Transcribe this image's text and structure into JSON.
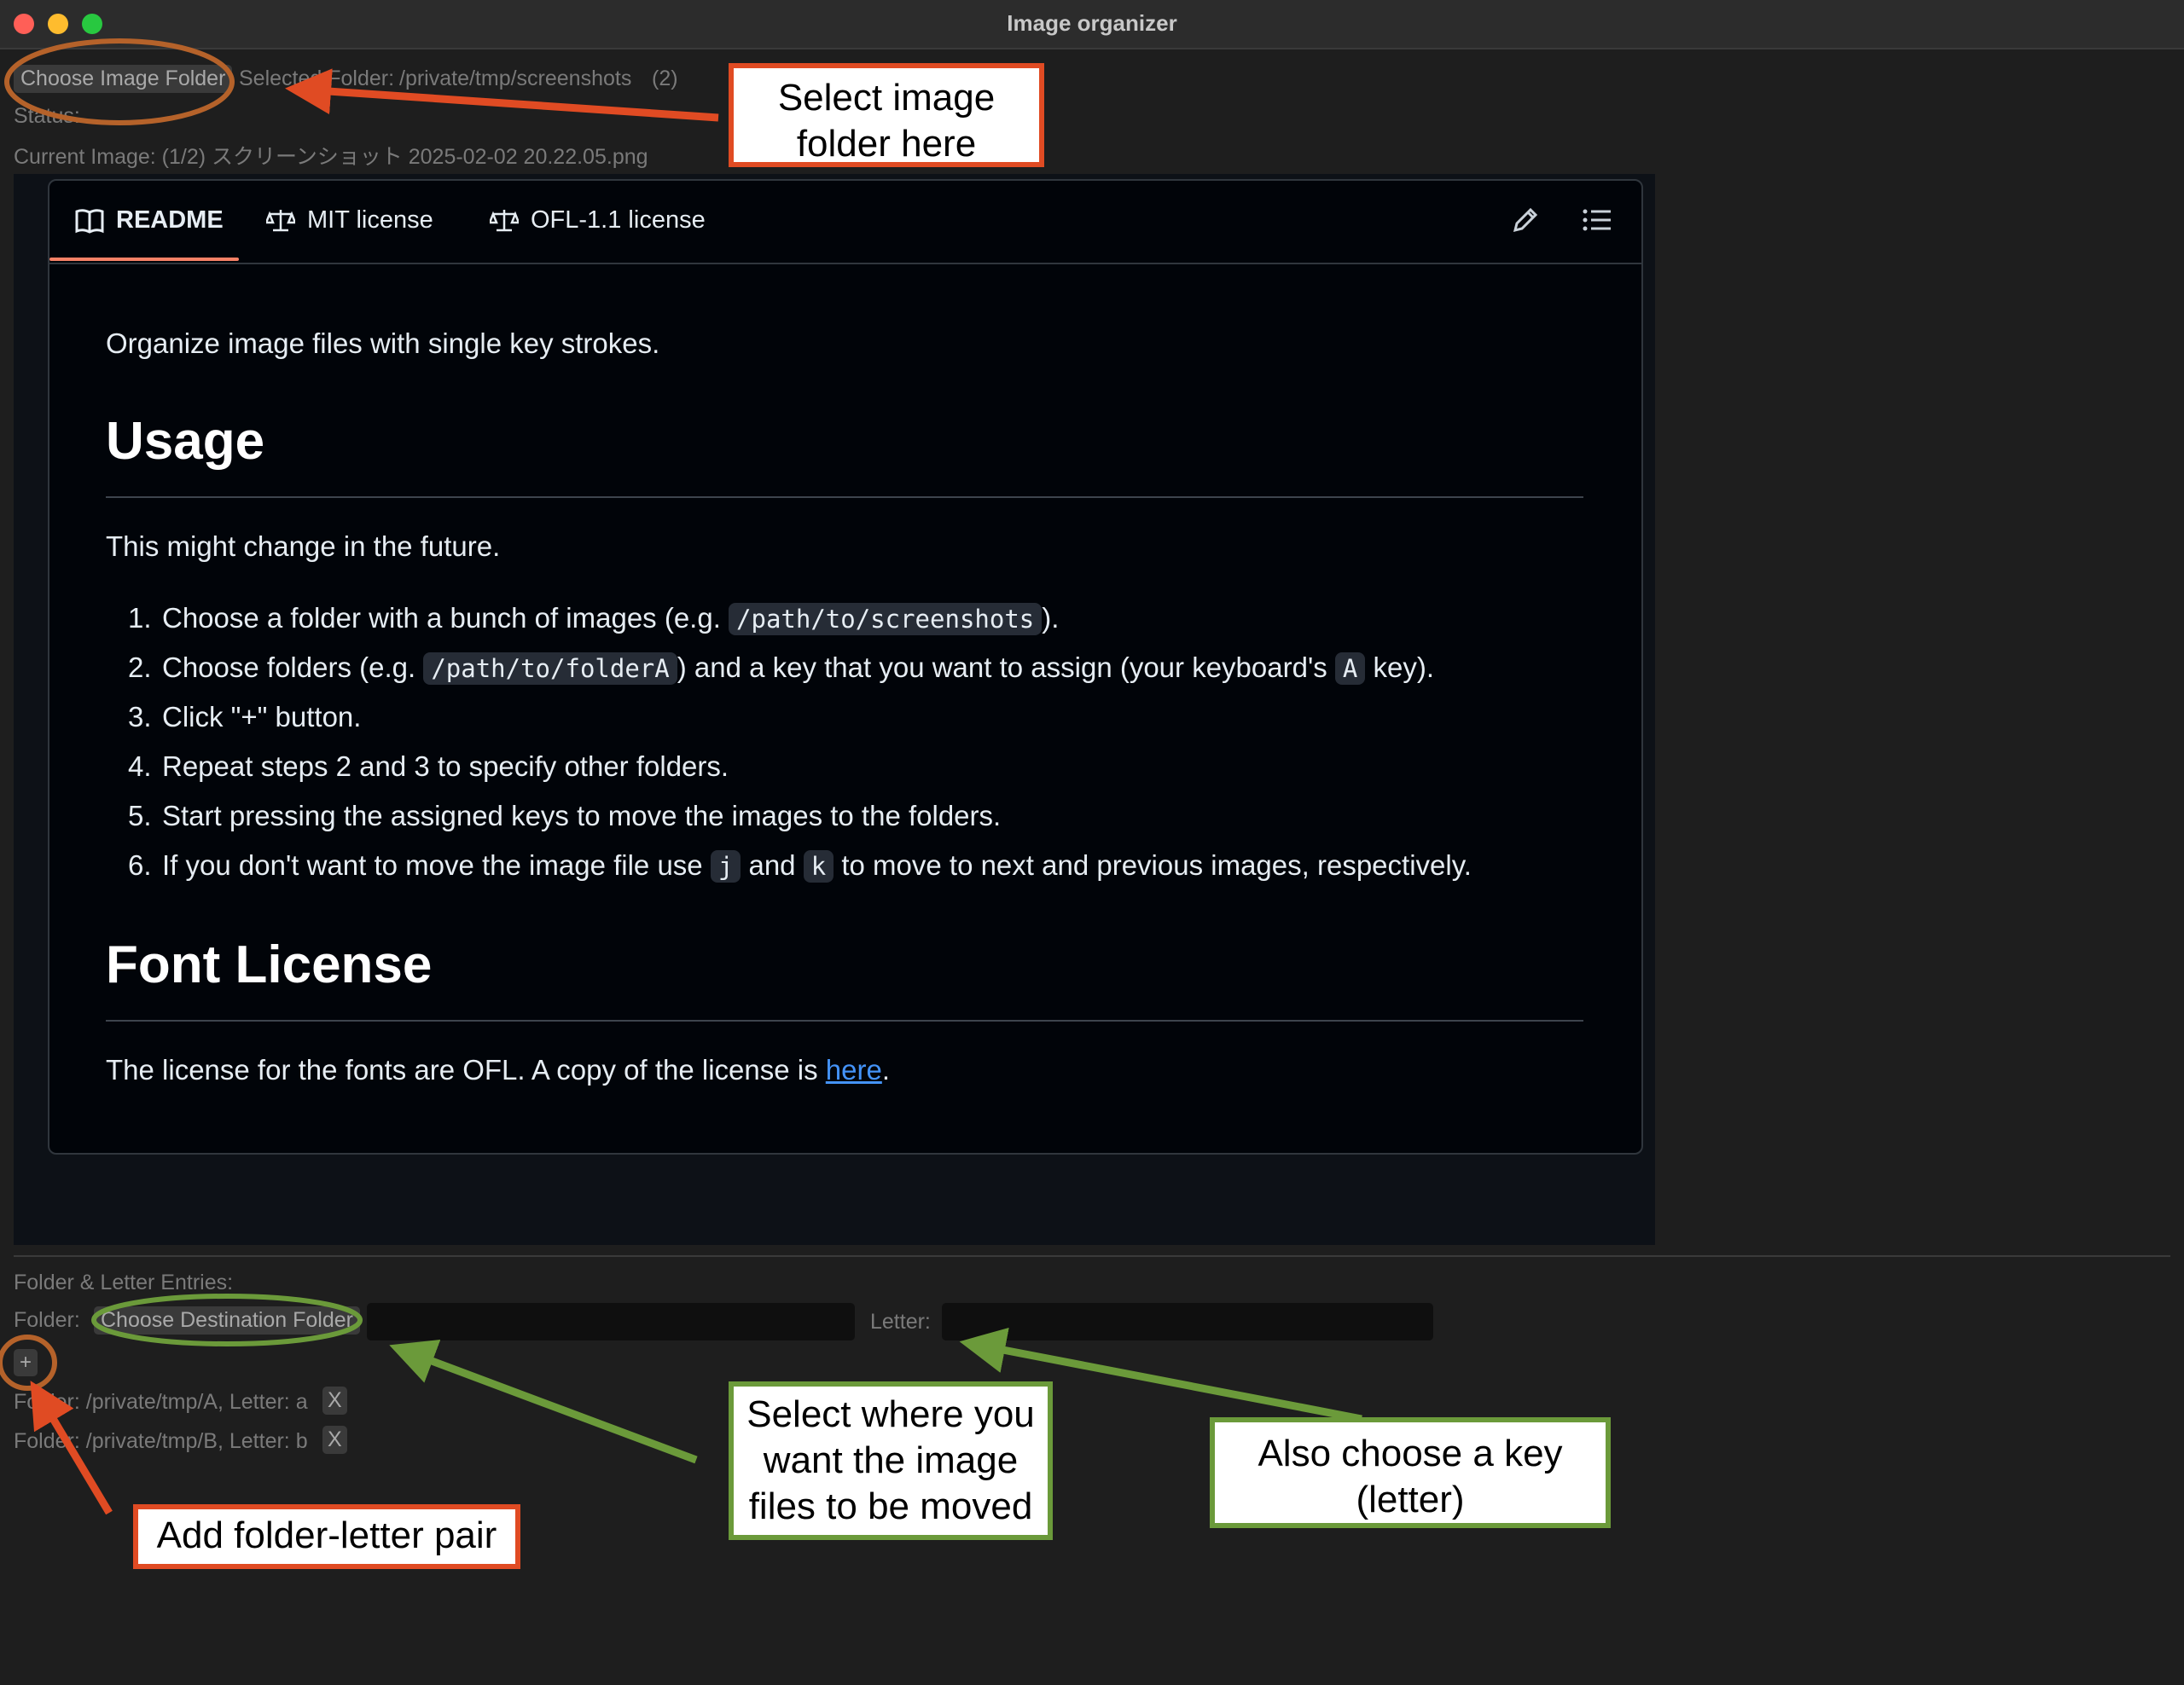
{
  "window": {
    "title": "Image organizer"
  },
  "top": {
    "choose_folder_button": "Choose Image Folder",
    "selected_folder_label": "Selected Folder:",
    "selected_folder_path": "/private/tmp/screenshots",
    "selected_folder_count": "(2)",
    "status_label": "Status:",
    "current_image": "Current Image: (1/2) スクリーンショット 2025-02-02 20.22.05.png"
  },
  "readme": {
    "tabs": [
      {
        "label": "README",
        "icon": "book-icon",
        "active": true
      },
      {
        "label": "MIT license",
        "icon": "scale-icon"
      },
      {
        "label": "OFL-1.1 license",
        "icon": "scale-icon"
      }
    ],
    "intro": "Organize image files with single key strokes.",
    "usage_heading": "Usage",
    "usage_note": "This might change in the future.",
    "steps": {
      "s1": {
        "num": "1.",
        "pre": "Choose a folder with a bunch of images (e.g. ",
        "code": "/path/to/screenshots",
        "post": ")."
      },
      "s2": {
        "num": "2.",
        "pre": "Choose folders (e.g. ",
        "code": "/path/to/folderA",
        "mid": ") and a key that you want to assign (your keyboard's ",
        "code2": "A",
        "post": " key)."
      },
      "s3": {
        "num": "3.",
        "text": "Click \"+\" button."
      },
      "s4": {
        "num": "4.",
        "text": "Repeat steps 2 and 3 to specify other folders."
      },
      "s5": {
        "num": "5.",
        "text": "Start pressing the assigned keys to move the images to the folders."
      },
      "s6": {
        "num": "6.",
        "pre": "If you don't want to move the image file use ",
        "code": "j",
        "mid": " and ",
        "code2": "k",
        "post": " to move to next and previous images, respectively."
      }
    },
    "font_heading": "Font License",
    "font_text": "The license for the fonts are OFL. A copy of the license is ",
    "font_link": "here",
    "font_end": "."
  },
  "entries": {
    "heading": "Folder & Letter Entries:",
    "folder_label": "Folder:",
    "choose_dest_button": "Choose Destination Folder",
    "letter_label": "Letter:",
    "add_button": "+",
    "items": [
      {
        "text": "Folder: /private/tmp/A, Letter: a",
        "remove": "X"
      },
      {
        "text": "Folder: /private/tmp/B, Letter: b",
        "remove": "X"
      }
    ]
  },
  "annotations": {
    "select_folder": [
      "Select image",
      "folder here"
    ],
    "add_pair": "Add folder-letter pair",
    "select_dest": [
      "Select where you",
      "want the image",
      "files to be moved"
    ],
    "choose_key": [
      "Also choose a key",
      "(letter)"
    ],
    "colors": {
      "red": "#e04b23",
      "green": "#6b9a3a",
      "brown": "#b5622a"
    }
  }
}
